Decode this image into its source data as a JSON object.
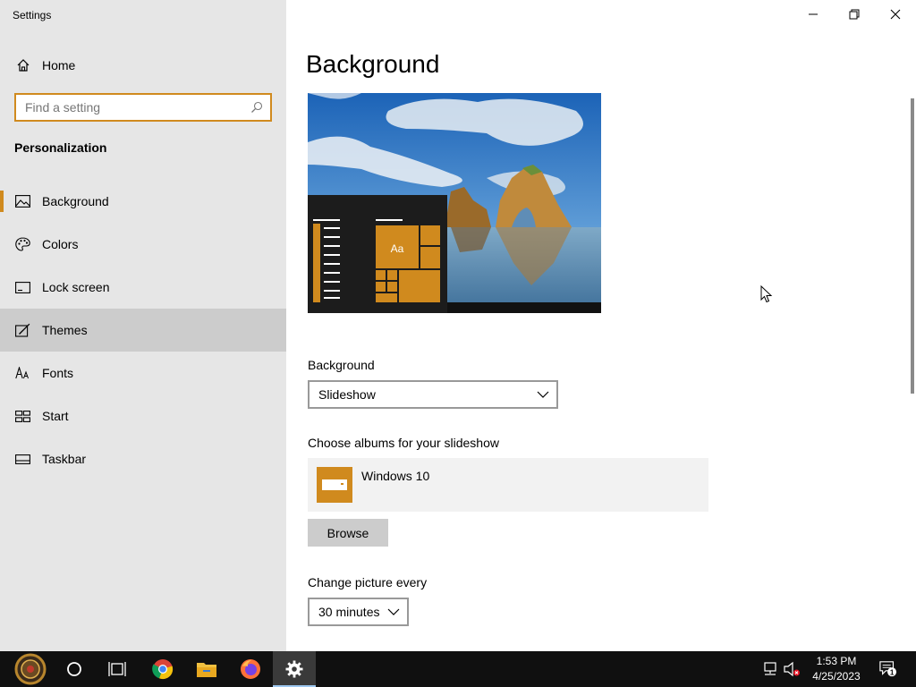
{
  "window": {
    "title": "Settings"
  },
  "sidebar": {
    "home_label": "Home",
    "search_placeholder": "Find a setting",
    "section_title": "Personalization",
    "items": [
      {
        "label": "Background",
        "icon": "picture-icon"
      },
      {
        "label": "Colors",
        "icon": "palette-icon"
      },
      {
        "label": "Lock screen",
        "icon": "lock-screen-icon"
      },
      {
        "label": "Themes",
        "icon": "brush-icon"
      },
      {
        "label": "Fonts",
        "icon": "font-icon"
      },
      {
        "label": "Start",
        "icon": "start-icon"
      },
      {
        "label": "Taskbar",
        "icon": "taskbar-icon"
      }
    ],
    "selected": "Background",
    "hovered": "Themes"
  },
  "main": {
    "title": "Background",
    "preview_tile_label": "Aa",
    "background_label": "Background",
    "background_value": "Slideshow",
    "albums_label": "Choose albums for your slideshow",
    "album_name": "Windows 10",
    "browse_label": "Browse",
    "change_picture_label": "Change picture every",
    "change_picture_value": "30 minutes"
  },
  "taskbar": {
    "time": "1:53 PM",
    "date": "4/25/2023",
    "notification_count": "1",
    "apps": [
      "start-icon",
      "cortana-icon",
      "task-view-icon",
      "chrome-icon",
      "file-explorer-icon",
      "firefox-icon",
      "settings-gear-icon"
    ]
  },
  "colors": {
    "accent": "#d08a1e",
    "sidebar_bg": "#e6e6e6",
    "taskbar_bg": "#101010"
  }
}
